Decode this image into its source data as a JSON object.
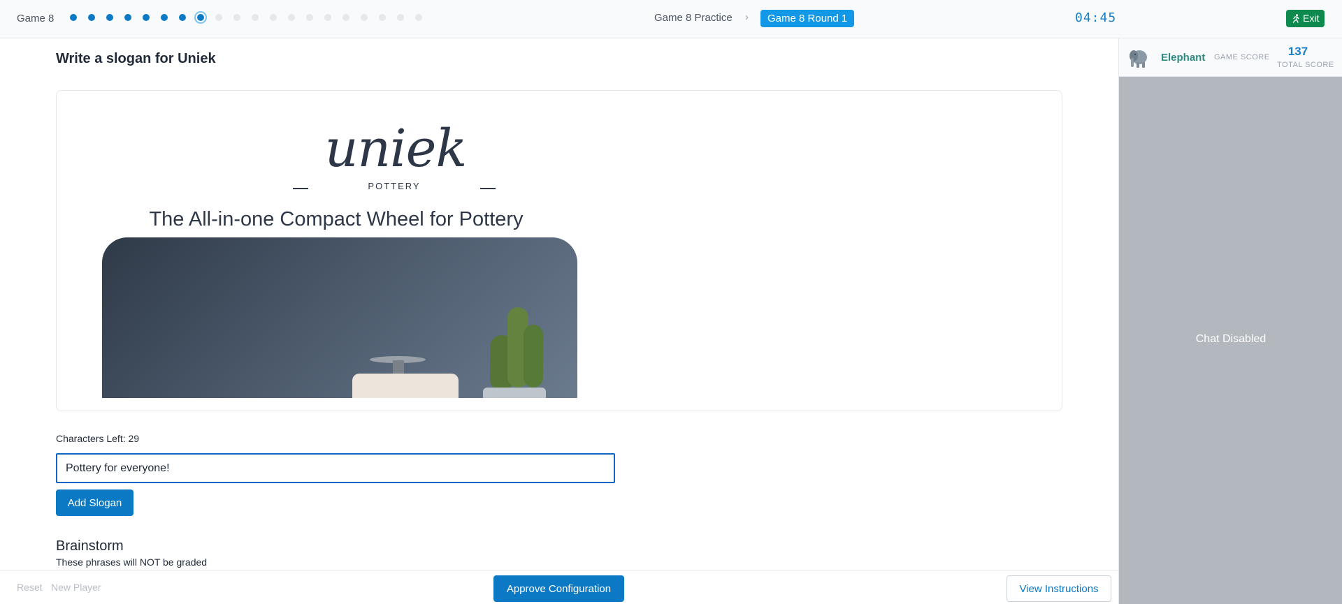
{
  "header": {
    "game_label": "Game 8",
    "progress": {
      "total_steps": 20,
      "completed_steps": 7,
      "current_step": 8
    },
    "breadcrumb": {
      "parent": "Game 8 Practice",
      "current": "Game 8 Round 1"
    },
    "timer": "04:45",
    "exit_label": "Exit"
  },
  "main": {
    "title": "Write a slogan for Uniek",
    "preview": {
      "logo_word": "uniek",
      "logo_sub": "POTTERY",
      "tagline": "The All-in-one Compact Wheel for Pottery"
    },
    "chars_left_label": "Characters Left: 29",
    "slogan_value": "Pottery for everyone!",
    "add_slogan_label": "Add Slogan",
    "brainstorm_title": "Brainstorm",
    "brainstorm_subtitle": "These phrases will NOT be graded"
  },
  "footer": {
    "reset_label": "Reset",
    "new_player_label": "New Player",
    "approve_label": "Approve Configuration",
    "instructions_label": "View Instructions"
  },
  "side": {
    "avatar_icon": "elephant-icon",
    "player_name": "Elephant",
    "game_score_label": "GAME SCORE",
    "total_score": "137",
    "total_score_label": "TOTAL SCORE",
    "chat_status": "Chat Disabled"
  },
  "colors": {
    "accent": "#0b79c4",
    "exit": "#0e8a4f",
    "player": "#2e8b84",
    "side_panel": "#b3b7be"
  }
}
